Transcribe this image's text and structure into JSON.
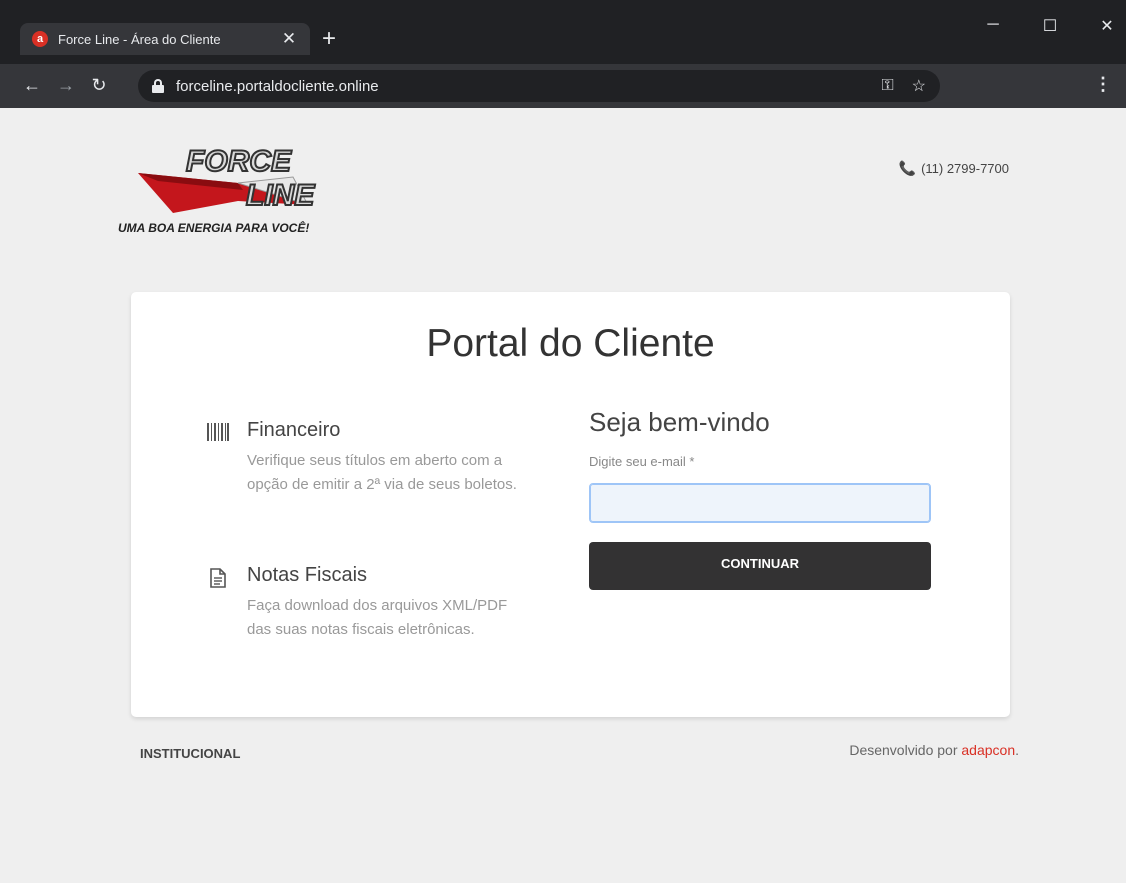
{
  "browser": {
    "tab_title": "Force Line - Área do Cliente",
    "tab_favicon_letter": "a",
    "new_tab_glyph": "+",
    "url": "forceline.portaldocliente.online",
    "icons": [
      "back-icon",
      "forward-icon",
      "reload-icon",
      "lock-icon",
      "key-icon",
      "star-icon",
      "menu-icon"
    ]
  },
  "header": {
    "logo_line1": "FORCE",
    "logo_line2": "LINE",
    "tagline": "UMA BOA ENERGIA PARA VOCÊ!",
    "phone": "(11) 2799-7700"
  },
  "card": {
    "title": "Portal do Cliente",
    "features": [
      {
        "icon": "barcode-icon",
        "title": "Financeiro",
        "description": "Verifique seus títulos em aberto com a opção de emitir a 2ª via de seus boletos."
      },
      {
        "icon": "document-icon",
        "title": "Notas Fiscais",
        "description": "Faça download dos arquivos XML/PDF das suas notas fiscais eletrônicas."
      }
    ],
    "login": {
      "welcome": "Seja bem-vindo",
      "email_label": "Digite seu e-mail *",
      "email_value": "",
      "button_label": "CONTINUAR"
    }
  },
  "footer": {
    "left_link": "INSTITUCIONAL",
    "credit_prefix": "Desenvolvido por ",
    "credit_link": "adapcon",
    "credit_suffix": "."
  },
  "colors": {
    "accent": "#d93025",
    "button_bg": "#333233",
    "page_bg": "#efefef",
    "logo_red": "#c4161c"
  }
}
